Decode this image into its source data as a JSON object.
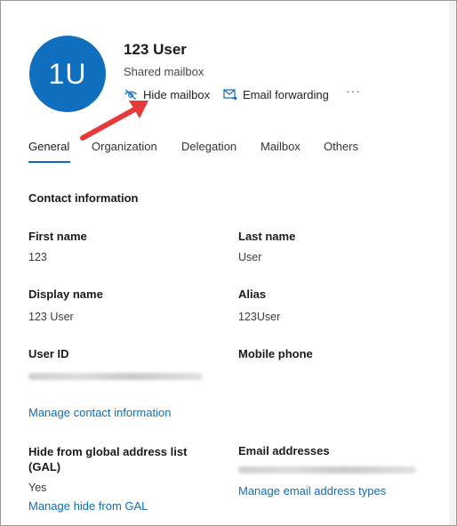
{
  "header": {
    "avatar_initials": "1U",
    "user_name": "123 User",
    "subtitle": "Shared mailbox",
    "actions": {
      "hide_mailbox": "Hide mailbox",
      "email_forwarding": "Email forwarding",
      "more": "···"
    },
    "icons": {
      "hide_mailbox": "eye-hidden-icon",
      "email_forwarding": "mail-forward-icon",
      "more": "more-horizontal-icon"
    }
  },
  "tabs": {
    "general": "General",
    "organization": "Organization",
    "delegation": "Delegation",
    "mailbox": "Mailbox",
    "others": "Others",
    "active": "General"
  },
  "contact": {
    "title": "Contact information",
    "first_name": {
      "label": "First name",
      "value": "123"
    },
    "last_name": {
      "label": "Last name",
      "value": "User"
    },
    "display_name": {
      "label": "Display name",
      "value": "123 User"
    },
    "alias": {
      "label": "Alias",
      "value": "123User"
    },
    "user_id": {
      "label": "User ID"
    },
    "mobile_phone": {
      "label": "Mobile phone"
    },
    "manage_link": "Manage contact information"
  },
  "gal": {
    "label": "Hide from global address list (GAL)",
    "value": "Yes",
    "manage_link": "Manage hide from GAL"
  },
  "email": {
    "label": "Email addresses",
    "manage_link": "Manage email address types"
  },
  "colors": {
    "accent": "#0f6cbd",
    "avatar": "#106ebe",
    "annotation_arrow": "#e5393a"
  }
}
